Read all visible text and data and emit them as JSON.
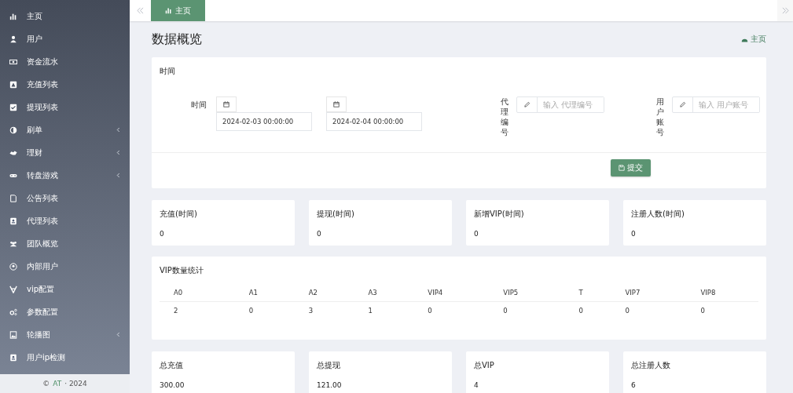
{
  "sidebar": {
    "items": [
      {
        "label": "主页",
        "expandable": false
      },
      {
        "label": "用户",
        "expandable": false
      },
      {
        "label": "资金流水",
        "expandable": false
      },
      {
        "label": "充值列表",
        "expandable": false
      },
      {
        "label": "提现列表",
        "expandable": false
      },
      {
        "label": "刷单",
        "expandable": true
      },
      {
        "label": "理财",
        "expandable": true
      },
      {
        "label": "转盘游戏",
        "expandable": true
      },
      {
        "label": "公告列表",
        "expandable": false
      },
      {
        "label": "代理列表",
        "expandable": false
      },
      {
        "label": "团队概览",
        "expandable": false
      },
      {
        "label": "内部用户",
        "expandable": false
      },
      {
        "label": "vip配置",
        "expandable": false
      },
      {
        "label": "参数配置",
        "expandable": false
      },
      {
        "label": "轮播图",
        "expandable": true
      },
      {
        "label": "用户ip检测",
        "expandable": false
      }
    ],
    "footer": {
      "symbol": "©",
      "brand": "AT",
      "year": "· 2024"
    }
  },
  "tabs": [
    {
      "label": "主页",
      "selected": true
    }
  ],
  "page_title": "数据概览",
  "breadcrumb": "主页",
  "filter": {
    "title": "时间",
    "time_label": "时间",
    "start": "2024-02-03 00:00:00",
    "end": "2024-02-04 00:00:00",
    "agent_label": "代理编号",
    "agent_placeholder": "输入 代理编号",
    "account_label": "用户账号",
    "account_placeholder": "输入 用户账号",
    "submit": "提交"
  },
  "period_stats": [
    {
      "label": "充值(时间)",
      "value": "0"
    },
    {
      "label": "提现(时间)",
      "value": "0"
    },
    {
      "label": "新增VIP(时间)",
      "value": "0"
    },
    {
      "label": "注册人数(时间)",
      "value": "0"
    }
  ],
  "vip_table": {
    "title": "VIP数量统计",
    "columns": [
      "A0",
      "A1",
      "A2",
      "A3",
      "VIP4",
      "VIP5",
      "T",
      "VIP7",
      "VIP8"
    ],
    "rows": [
      [
        "2",
        "0",
        "3",
        "1",
        "0",
        "0",
        "0",
        "0",
        "0"
      ]
    ]
  },
  "total_stats": [
    {
      "label": "总充值",
      "value": "300.00"
    },
    {
      "label": "总提现",
      "value": "121.00"
    },
    {
      "label": "总VIP",
      "value": "4"
    },
    {
      "label": "总注册人数",
      "value": "6"
    }
  ]
}
